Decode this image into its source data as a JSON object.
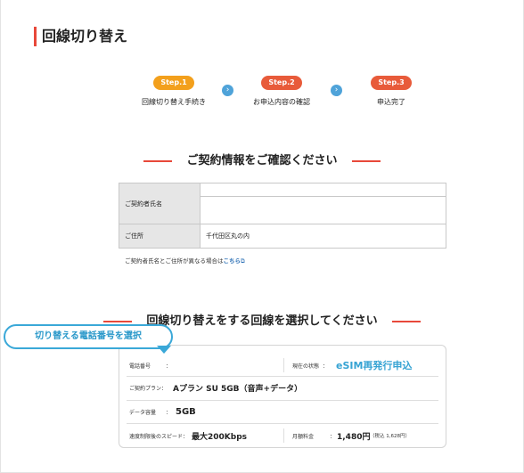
{
  "page_title": "回線切り替え",
  "steps": [
    {
      "badge": "Step.1",
      "label": "回線切り替え手続き",
      "color": "#f3a01c"
    },
    {
      "badge": "Step.2",
      "label": "お申込内容の確認",
      "color": "#e85b3a"
    },
    {
      "badge": "Step.3",
      "label": "申込完了",
      "color": "#e85b3a"
    }
  ],
  "contract_section": {
    "heading": "ご契約情報をご確認ください",
    "rows": [
      {
        "label": "ご契約者氏名",
        "value": ""
      },
      {
        "label": "ご住所",
        "value": "千代田区丸の内"
      }
    ],
    "note_text": "ご契約者氏名とご住所が異なる場合は",
    "note_link": "こちら"
  },
  "line_section": {
    "heading": "回線切り替えをする回線を選択してください",
    "callout": "切り替える電話番号を選択",
    "card": {
      "phone_label": "電話番号",
      "phone_colon": "：",
      "status_label": "現在の状態",
      "status_colon": "：",
      "status_value": "eSIM再発行申込",
      "plan_label": "ご契約プラン：",
      "plan_value": "Aプラン SU 5GB（音声+データ）",
      "data_label": "データ容量",
      "data_colon": "：",
      "data_value": "5GB",
      "speed_label": "速度制限後のスピード：",
      "speed_value": "最大200Kbps",
      "fee_label": "月額料金",
      "fee_colon": "：",
      "fee_value": "1,480円",
      "fee_tax": "（税込 1,628円）"
    }
  },
  "colors": {
    "accent": "#e8483a",
    "link": "#2a6fb5",
    "callout": "#3aa8d8"
  }
}
